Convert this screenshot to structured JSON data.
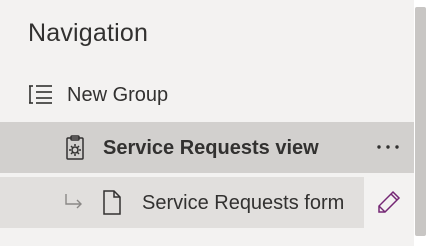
{
  "panel": {
    "title": "Navigation"
  },
  "items": [
    {
      "label": "New Group",
      "icon": "list-icon"
    },
    {
      "label": "Service Requests view",
      "icon": "clipboard-settings-icon",
      "selected": true,
      "more_icon": "more-horizontal-icon"
    },
    {
      "label": "Service Requests form",
      "icon": "page-icon",
      "sub_icon": "sub-item-arrow-icon",
      "action_icon": "edit-pencil-icon"
    }
  ],
  "colors": {
    "panel_bg": "#f3f2f1",
    "selected_bg": "#d2d0ce",
    "hover_bg": "#e1dfdd",
    "text": "#323130",
    "accent": "#742774"
  }
}
